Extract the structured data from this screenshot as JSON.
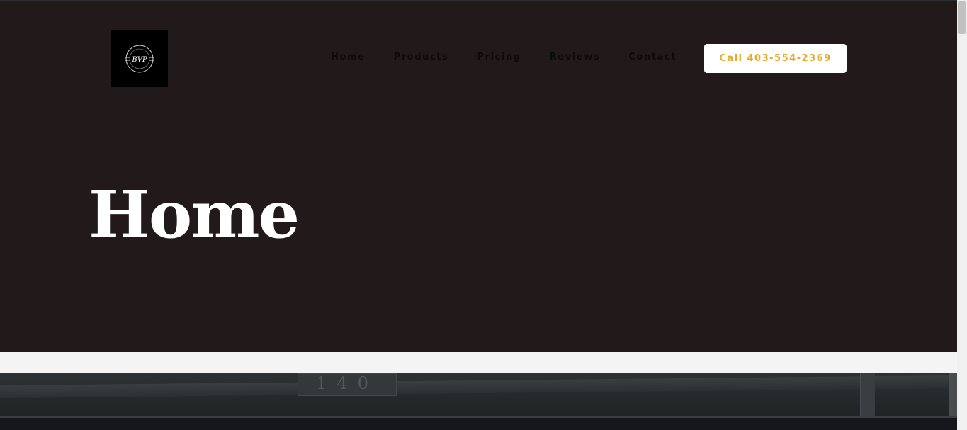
{
  "logo": {
    "text": "BVP",
    "ring_text": "BRANDED VINYL PROTECTION",
    "icon": "logo-badge-icon"
  },
  "nav": {
    "items": [
      {
        "label": "Home"
      },
      {
        "label": "Products"
      },
      {
        "label": "Pricing"
      },
      {
        "label": "Reviews"
      },
      {
        "label": "Contact"
      }
    ]
  },
  "cta": {
    "label": "Call 403-554-2369"
  },
  "hero": {
    "title": "Home"
  },
  "photo": {
    "plate_text": "140"
  },
  "colors": {
    "hero_bg": "#221a1a",
    "cta_text": "#e8a926",
    "nav_text": "#0b0b0b",
    "title_text": "#ffffff"
  }
}
